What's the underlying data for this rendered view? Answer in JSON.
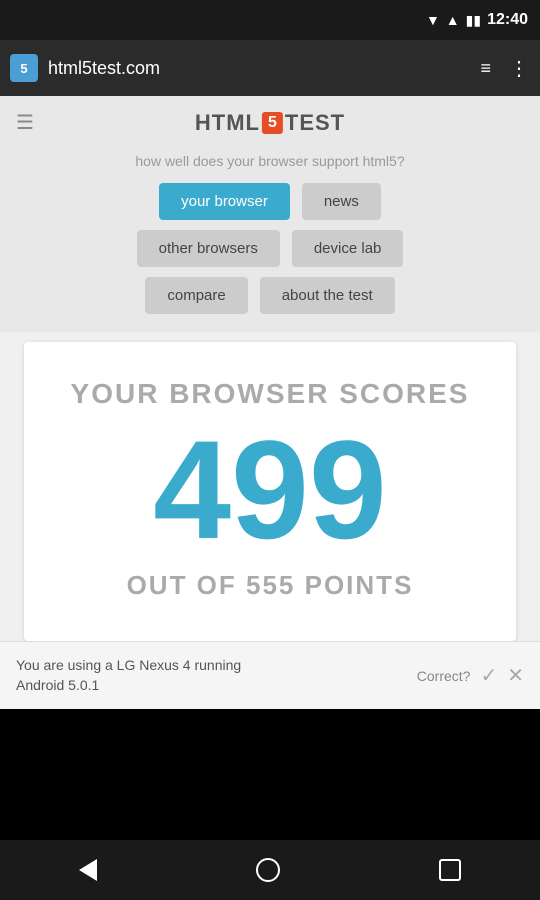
{
  "statusBar": {
    "time": "12:40"
  },
  "browserBar": {
    "favicon": "5",
    "url": "html5test.com",
    "menuLinesLabel": "≡",
    "menuDotsLabel": "⋮"
  },
  "header": {
    "hamburgerLabel": "☰",
    "logoHtml": "HTML",
    "logoBadge": "5",
    "logoTest": "TEST",
    "tagline": "how well does your browser support html5?"
  },
  "navButtons": {
    "row1": [
      {
        "label": "your browser",
        "active": true
      },
      {
        "label": "news",
        "active": false
      }
    ],
    "row2": [
      {
        "label": "other browsers",
        "active": false
      },
      {
        "label": "device lab",
        "active": false
      }
    ],
    "row3": [
      {
        "label": "compare",
        "active": false
      },
      {
        "label": "about the test",
        "active": false
      }
    ]
  },
  "scoreCard": {
    "title": "YOUR BROWSER SCORES",
    "score": "499",
    "outOf": "OUT OF 555 POINTS"
  },
  "bottomBar": {
    "deviceInfo": "You are using a LG Nexus 4 running\nAndroid 5.0.1",
    "correctLabel": "Correct?",
    "checkLabel": "✓",
    "xLabel": "✕"
  }
}
